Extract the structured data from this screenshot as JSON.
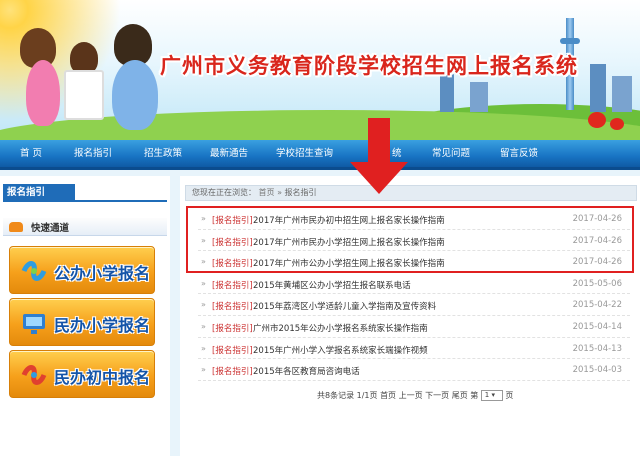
{
  "header": {
    "title": "广州市义务教育阶段学校招生网上报名系统"
  },
  "nav": {
    "items": [
      {
        "label": "首 页"
      },
      {
        "label": "报名指引"
      },
      {
        "label": "招生政策"
      },
      {
        "label": "最新通告"
      },
      {
        "label": "学校招生查询"
      },
      {
        "label": "统"
      },
      {
        "label": "常见问题"
      },
      {
        "label": "留言反馈"
      }
    ]
  },
  "sidebar": {
    "heading": "报名指引",
    "quick_label": "快速通道",
    "buttons": [
      {
        "label": "公办小学报名",
        "icon": "ribbon-icon"
      },
      {
        "label": "民办小学报名",
        "icon": "monitor-icon"
      },
      {
        "label": "民办初中报名",
        "icon": "ribbon-icon"
      }
    ]
  },
  "breadcrumb": {
    "prefix": "您现在正在浏览：",
    "home": "首页",
    "sep": " » ",
    "current": "报名指引"
  },
  "list": {
    "items": [
      {
        "category": "[报名指引]",
        "title": "2017年广州市民办初中招生网上报名家长操作指南",
        "date": "2017-04-26"
      },
      {
        "category": "[报名指引]",
        "title": "2017年广州市民办小学招生网上报名家长操作指南",
        "date": "2017-04-26"
      },
      {
        "category": "[报名指引]",
        "title": "2017年广州市公办小学招生网上报名家长操作指南",
        "date": "2017-04-26"
      },
      {
        "category": "[报名指引]",
        "title": "2015年黄埔区公办小学招生报名联系电话",
        "date": "2015-05-06"
      },
      {
        "category": "[报名指引]",
        "title": "2015年荔湾区小学适龄儿童入学指南及宣传资料",
        "date": "2015-04-22"
      },
      {
        "category": "[报名指引]",
        "title": "广州市2015年公办小学报名系统家长操作指南",
        "date": "2015-04-14"
      },
      {
        "category": "[报名指引]",
        "title": "2015年广州小学入学报名系统家长端操作视频",
        "date": "2015-04-13"
      },
      {
        "category": "[报名指引]",
        "title": "2015年各区教育局咨询电话",
        "date": "2015-04-03"
      }
    ]
  },
  "pager": {
    "summary": "共8条记录 1/1页",
    "first": "首页",
    "prev": "上一页",
    "next": "下一页",
    "last": "尾页",
    "goto_prefix": "第",
    "goto_value": "1",
    "goto_suffix": "页"
  },
  "colors": {
    "nav_blue": "#1874c4",
    "highlight_red": "#e02020",
    "button_orange": "#f6a01b",
    "category_red": "#cc3333"
  }
}
